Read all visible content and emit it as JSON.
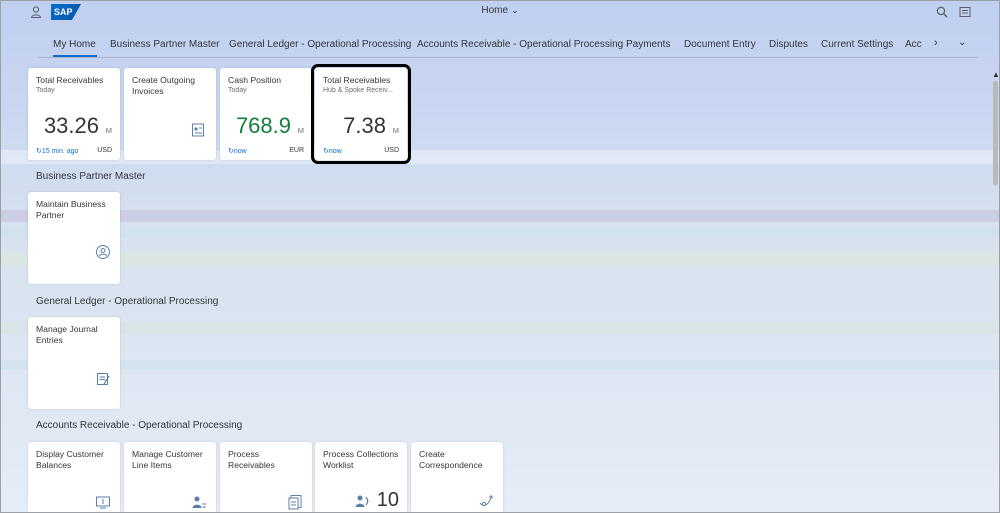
{
  "shell": {
    "title": "Home",
    "logo_text": "SAP"
  },
  "anchor_nav": {
    "items": [
      "My Home",
      "Business Partner Master",
      "General Ledger - Operational Processing",
      "Accounts Receivable - Operational Processing",
      "Payments",
      "Document Entry",
      "Disputes",
      "Current Settings",
      "Acc"
    ],
    "selected_index": 0
  },
  "groups": {
    "my_home": {
      "tiles": [
        {
          "title": "Total Receivables",
          "subtitle": "Today",
          "value": "33.26",
          "scale": "M",
          "refresh": "15 min. ago",
          "unit": "USD"
        },
        {
          "title": "Create Outgoing Invoices"
        },
        {
          "title": "Cash Position",
          "subtitle": "Today",
          "value": "768.9",
          "scale": "M",
          "refresh": "now",
          "unit": "EUR",
          "value_color": "#107e3e"
        },
        {
          "title": "Total Receivables",
          "subtitle": "Hub & Spoke Receiv...",
          "value": "7.38",
          "scale": "M",
          "refresh": "now",
          "unit": "USD"
        }
      ]
    },
    "business_partner": {
      "title": "Business Partner Master",
      "tiles": [
        {
          "title": "Maintain Business Partner",
          "icon": "user-settings-icon"
        }
      ]
    },
    "general_ledger": {
      "title": "General Ledger - Operational Processing",
      "tiles": [
        {
          "title": "Manage Journal Entries",
          "icon": "journal-entries-icon"
        }
      ]
    },
    "accounts_receivable": {
      "title": "Accounts Receivable - Operational Processing",
      "tiles": [
        {
          "title": "Display Customer Balances",
          "icon": "balances-icon"
        },
        {
          "title": "Manage Customer Line Items",
          "icon": "customer-items-icon"
        },
        {
          "title": "Process Receivables",
          "icon": "receivables-icon"
        },
        {
          "title": "Process Collections Worklist",
          "count": "10",
          "icon": "collections-icon"
        },
        {
          "title": "Create Correspondence",
          "icon": "correspondence-icon"
        }
      ]
    }
  },
  "colors": {
    "accent": "#0a6ed1",
    "positive": "#107e3e",
    "text": "#32363a"
  }
}
